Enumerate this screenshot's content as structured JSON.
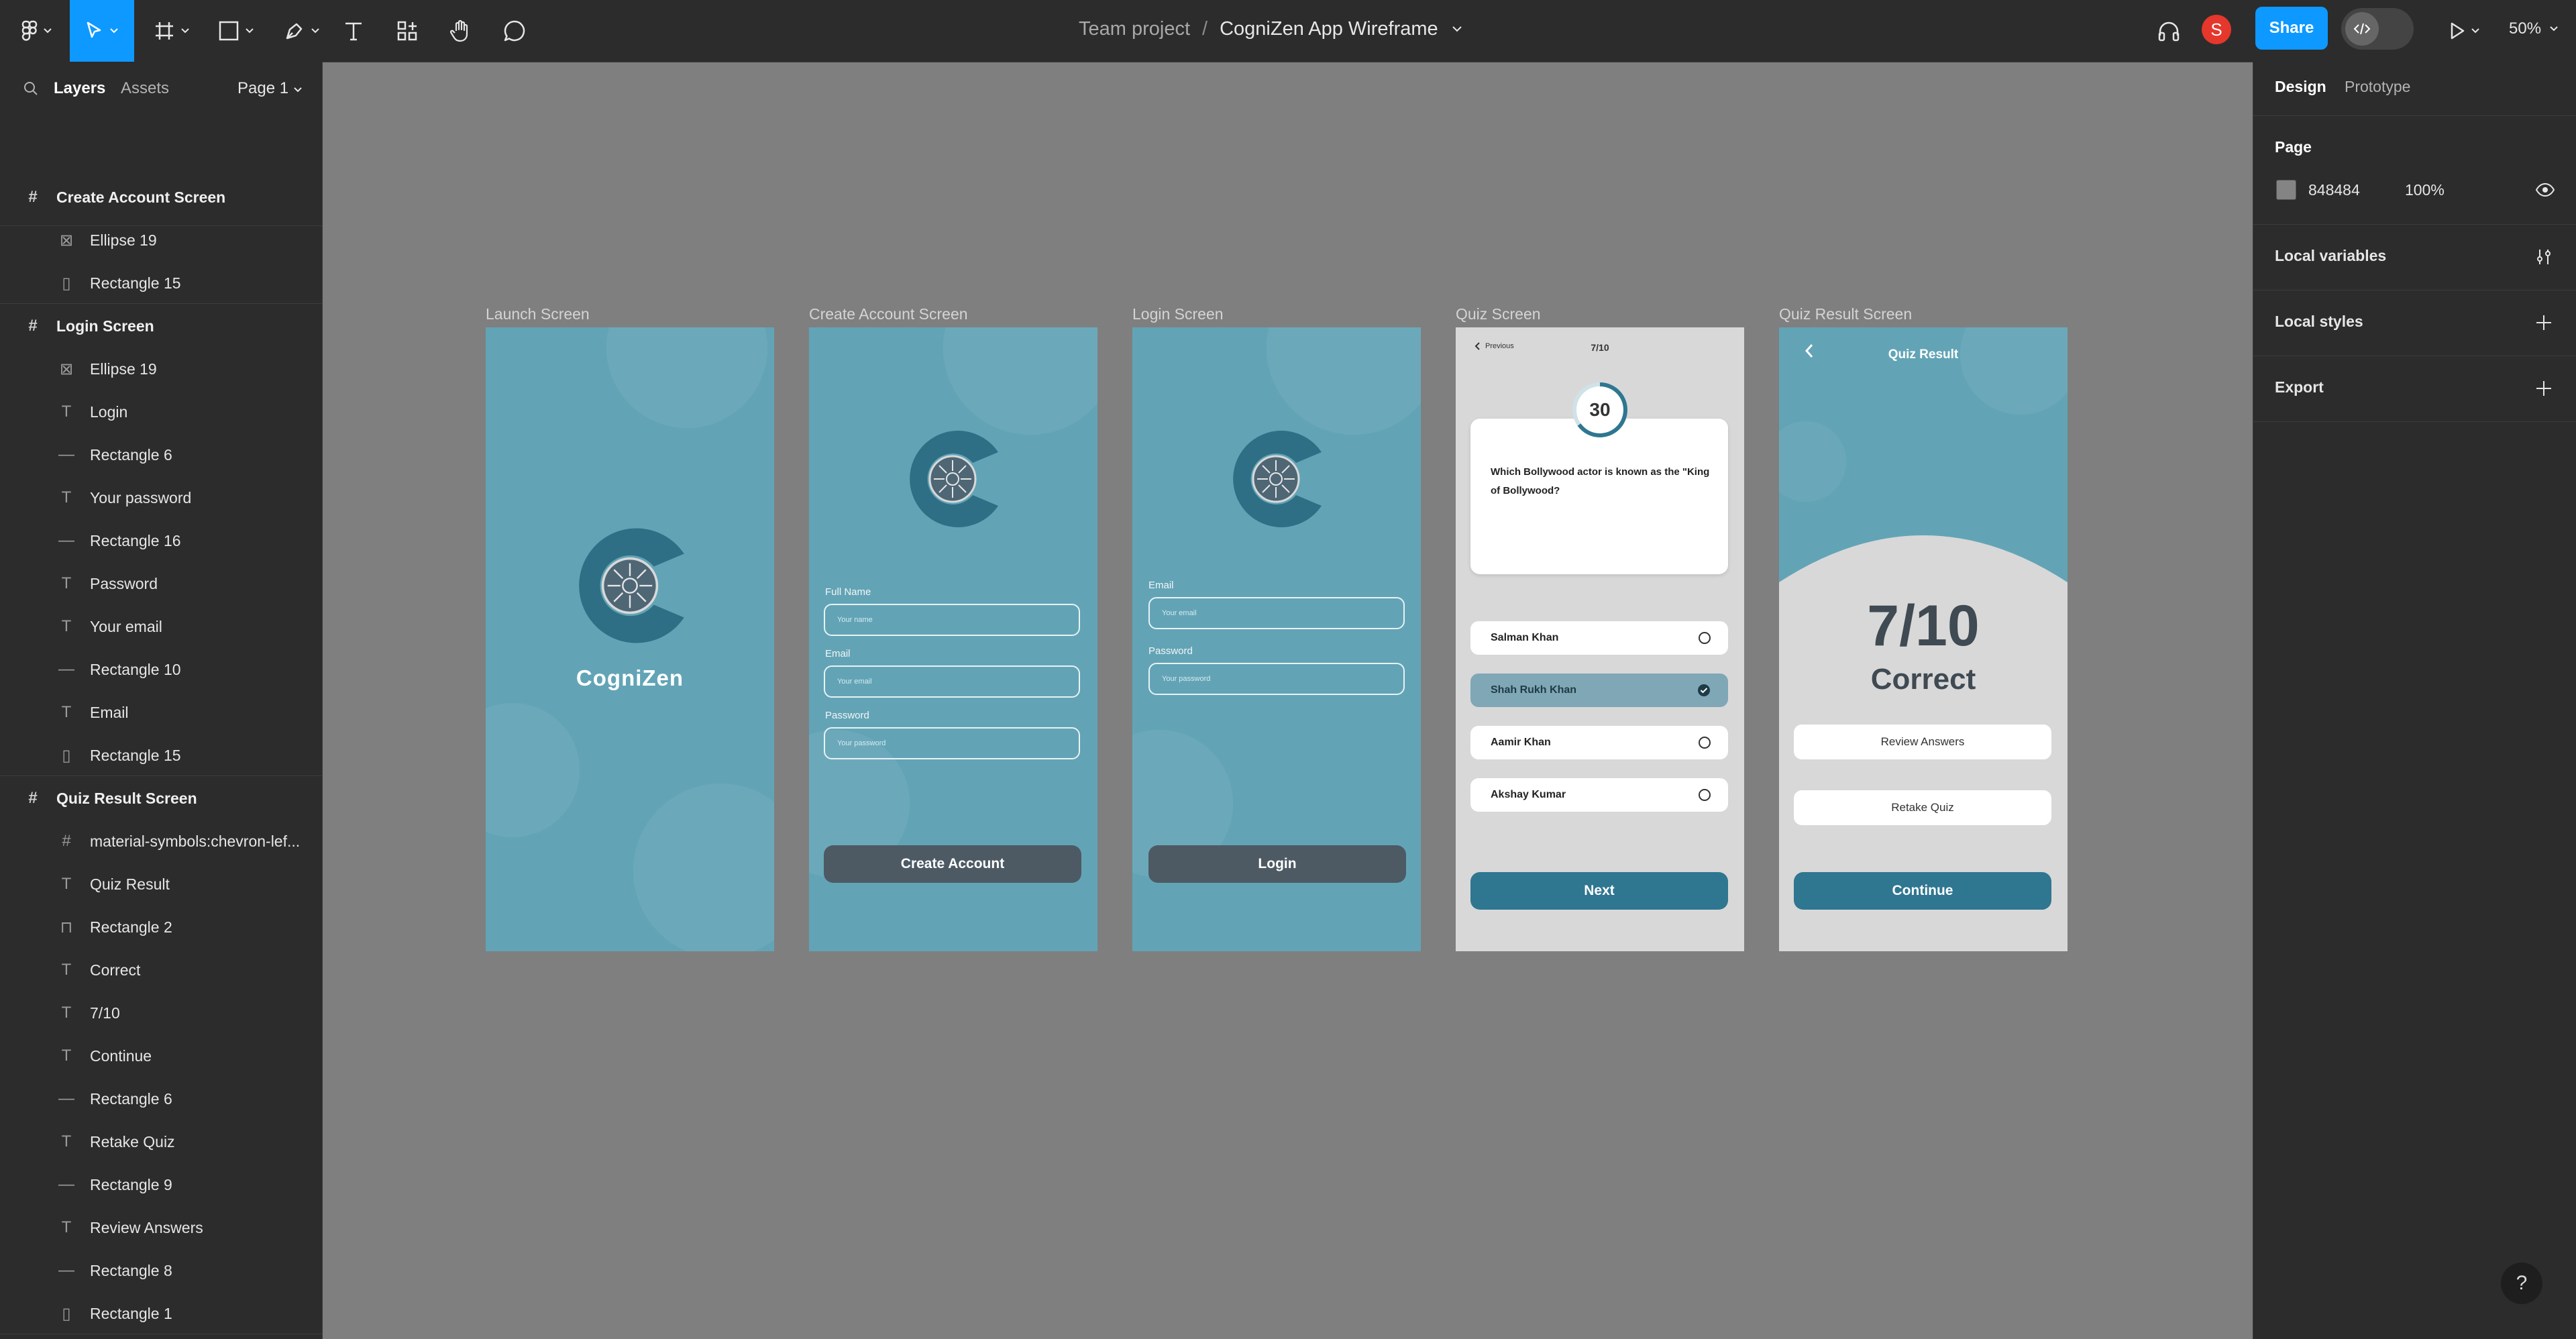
{
  "toolbar": {
    "breadcrumb_project": "Team project",
    "breadcrumb_sep": "/",
    "file_name": "CogniZen App Wireframe",
    "avatar_initial": "S",
    "share_label": "Share",
    "zoom": "50%",
    "tool_icons": [
      "figma-menu-icon",
      "move-icon",
      "frame-icon",
      "rectangle-icon",
      "pen-icon",
      "text-icon",
      "components-icon",
      "hand-icon",
      "comment-icon"
    ]
  },
  "left_panel": {
    "tab_layers": "Layers",
    "tab_assets": "Assets",
    "page_selector": "Page 1",
    "layers": [
      {
        "kind": "frame",
        "label": "Create Account Screen",
        "icon": "#"
      },
      {
        "kind": "image",
        "label": "Ellipse 19",
        "icon": "⊠"
      },
      {
        "kind": "rect",
        "label": "Rectangle 15",
        "icon": "▯"
      },
      {
        "kind": "frame",
        "label": "Login Screen",
        "icon": "#"
      },
      {
        "kind": "image",
        "label": "Ellipse 19",
        "icon": "⊠"
      },
      {
        "kind": "text",
        "label": "Login",
        "icon": "T"
      },
      {
        "kind": "line",
        "label": "Rectangle 6",
        "icon": "—"
      },
      {
        "kind": "text",
        "label": "Your password",
        "icon": "T"
      },
      {
        "kind": "line",
        "label": "Rectangle 16",
        "icon": "—"
      },
      {
        "kind": "text",
        "label": "Password",
        "icon": "T"
      },
      {
        "kind": "text",
        "label": "Your email",
        "icon": "T"
      },
      {
        "kind": "line",
        "label": "Rectangle 10",
        "icon": "—"
      },
      {
        "kind": "text",
        "label": "Email",
        "icon": "T"
      },
      {
        "kind": "rect",
        "label": "Rectangle 15",
        "icon": "▯"
      },
      {
        "kind": "frame",
        "label": "Quiz Result Screen",
        "icon": "#"
      },
      {
        "kind": "frame-child",
        "label": "material-symbols:chevron-lef...",
        "icon": "#"
      },
      {
        "kind": "text",
        "label": "Quiz Result",
        "icon": "T"
      },
      {
        "kind": "bookmark",
        "label": "Rectangle 2",
        "icon": "⊓"
      },
      {
        "kind": "text",
        "label": "Correct",
        "icon": "T"
      },
      {
        "kind": "text",
        "label": "7/10",
        "icon": "T"
      },
      {
        "kind": "text",
        "label": "Continue",
        "icon": "T"
      },
      {
        "kind": "line",
        "label": "Rectangle 6",
        "icon": "—"
      },
      {
        "kind": "text",
        "label": "Retake Quiz",
        "icon": "T"
      },
      {
        "kind": "line",
        "label": "Rectangle 9",
        "icon": "—"
      },
      {
        "kind": "text",
        "label": "Review Answers",
        "icon": "T"
      },
      {
        "kind": "line",
        "label": "Rectangle 8",
        "icon": "—"
      },
      {
        "kind": "rect",
        "label": "Rectangle 1",
        "icon": "▯"
      },
      {
        "kind": "frame",
        "label": "Quiz Screen",
        "icon": "#"
      }
    ]
  },
  "right_panel": {
    "tab_design": "Design",
    "tab_prototype": "Prototype",
    "page_heading": "Page",
    "page_color": "848484",
    "page_opacity": "100%",
    "local_variables": "Local variables",
    "local_styles": "Local styles",
    "export": "Export",
    "help": "?"
  },
  "canvas": {
    "frame_labels": [
      "Launch Screen",
      "Create Account Screen",
      "Login Screen",
      "Quiz Screen",
      "Quiz Result Screen"
    ],
    "launch": {
      "app_name": "CogniZen"
    },
    "create_account": {
      "full_name_label": "Full Name",
      "full_name_placeholder": "Your name",
      "email_label": "Email",
      "email_placeholder": "Your email",
      "password_label": "Password",
      "password_placeholder": "Your password",
      "button": "Create Account"
    },
    "login": {
      "email_label": "Email",
      "email_placeholder": "Your email",
      "password_label": "Password",
      "password_placeholder": "Your password",
      "button": "Login"
    },
    "quiz": {
      "previous": "Previous",
      "progress": "7/10",
      "timer": "30",
      "question": "Which Bollywood actor is known as the \"King of Bollywood?",
      "options": [
        "Salman Khan",
        "Shah Rukh Khan",
        "Aamir Khan",
        "Akshay Kumar"
      ],
      "selected_option": "Shah Rukh Khan",
      "next": "Next"
    },
    "result": {
      "title": "Quiz Result",
      "score": "7/10",
      "correct": "Correct",
      "review": "Review Answers",
      "retake": "Retake Quiz",
      "continue": "Continue"
    }
  },
  "colors": {
    "teal_screen": "#62a4b6",
    "accent_blue": "#0d99ff",
    "canvas_bg": "#7f7f7f",
    "logo_dark": "#2e6f86",
    "quiz_button": "#2f7690"
  }
}
